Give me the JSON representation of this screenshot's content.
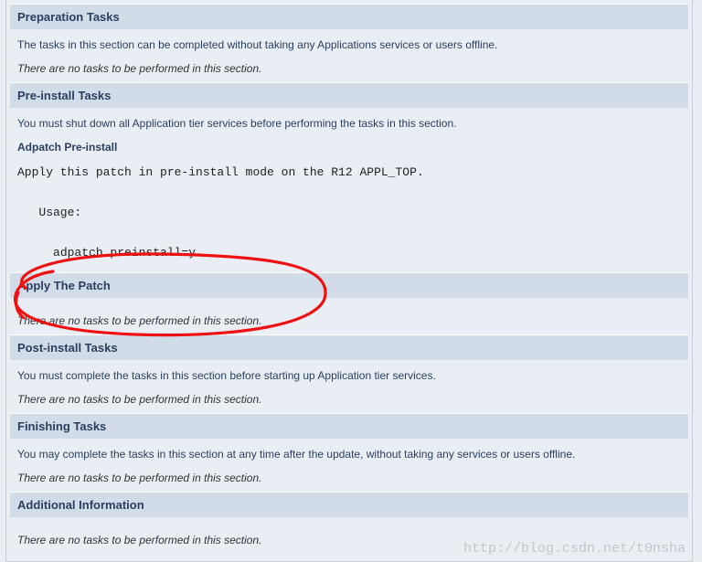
{
  "sections": {
    "preparation": {
      "title": "Preparation Tasks",
      "desc": "The tasks in this section can be completed without taking any Applications services or users offline.",
      "empty": "There are no tasks to be performed in this section."
    },
    "preinstall": {
      "title": "Pre-install Tasks",
      "desc": "You must shut down all Application tier services before performing the tasks in this section.",
      "sub": "Adpatch Pre-install",
      "mono": "Apply this patch in pre-install mode on the R12 APPL_TOP.\n\n   Usage:\n\n     adpatch preinstall=y"
    },
    "apply": {
      "title": "Apply The Patch",
      "empty": "There are no tasks to be performed in this section."
    },
    "postinstall": {
      "title": "Post-install Tasks",
      "desc": "You must complete the tasks in this section before starting up Application tier services.",
      "empty": "There are no tasks to be performed in this section."
    },
    "finishing": {
      "title": "Finishing Tasks",
      "desc": "You may complete the tasks in this section at any time after the update, without taking any services or users offline.",
      "empty": "There are no tasks to be performed in this section."
    },
    "additional": {
      "title": "Additional Information",
      "empty": "There are no tasks to be performed in this section."
    }
  },
  "watermark": "http://blog.csdn.net/t0nsha"
}
